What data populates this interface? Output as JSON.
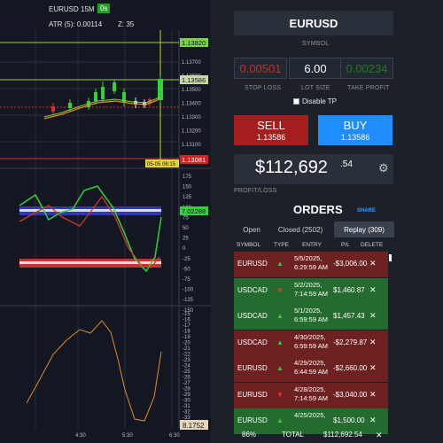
{
  "chart": {
    "symbol_tf": "EURUSD 15M",
    "tf_badge": "0s",
    "atr": "ATR (5): 0.00114",
    "z": "Z: 35",
    "price_ticks": [
      "1.13700",
      "1.13600",
      "1.13500",
      "1.13400",
      "1.13300",
      "1.13200",
      "1.13100"
    ],
    "labels": {
      "top_line": "1.13820",
      "current": "1.13586",
      "stop": "1.13081",
      "time": "05-05 06:15",
      "indicator_green": "7.02288",
      "indicator_orange": "8.1752"
    },
    "indicator_ticks": [
      "175",
      "150",
      "125",
      "100",
      "75",
      "50",
      "25",
      "0",
      "-25",
      "-50",
      "-75",
      "-100",
      "-125",
      "-150"
    ],
    "osc_ticks": [
      "-15",
      "-16",
      "-17",
      "-18",
      "-19",
      "-20",
      "-21",
      "-22",
      "-23",
      "-24",
      "-25",
      "-26",
      "-27",
      "-28",
      "-29",
      "-30",
      "-31",
      "-32",
      "-33"
    ],
    "time_ticks": [
      "4:30",
      "5:30",
      "6:30"
    ]
  },
  "trade": {
    "symbol": "EURUSD",
    "symbol_caption": "SYMBOL",
    "stop_loss": "0.00501",
    "stop_loss_caption": "STOP LOSS",
    "lot_size": "6.00",
    "lot_size_caption": "LOT SIZE",
    "take_profit": "0.00234",
    "take_profit_caption": "TAKE PROFIT",
    "disable_tp": "Disable TP",
    "sell_label": "SELL",
    "sell_price": "1.13586",
    "buy_label": "BUY",
    "buy_price": "1.13586",
    "pl_value": "$112,692",
    "pl_decimal": ".54",
    "pl_caption": "PROFIT/LOSS"
  },
  "orders": {
    "title": "ORDERS",
    "share": "SHARE",
    "tabs": [
      "Open",
      "Closed (2502)",
      "Replay (309)"
    ],
    "columns": [
      "SYMBOL",
      "TYPE",
      "ENTRY",
      "P/L",
      "DELETE"
    ],
    "rows": [
      {
        "symbol": "EURUSD",
        "dir": "up",
        "date": "5/5/2025,",
        "time": "6:29:59 AM",
        "pl": "-$3,006.00"
      },
      {
        "symbol": "USDCAD",
        "dir": "down",
        "date": "5/2/2025,",
        "time": "7:14:59 AM",
        "pl": "$1,460.87"
      },
      {
        "symbol": "USDCAD",
        "dir": "up",
        "date": "5/1/2025,",
        "time": "6:59:59 AM",
        "pl": "$1,457.43"
      },
      {
        "symbol": "USDCAD",
        "dir": "up",
        "date": "4/30/2025,",
        "time": "6:59:59 AM",
        "pl": "-$2,279.87"
      },
      {
        "symbol": "EURUSD",
        "dir": "up",
        "date": "4/29/2025,",
        "time": "6:44:59 AM",
        "pl": "-$2,660.00"
      },
      {
        "symbol": "EURUSD",
        "dir": "down",
        "date": "4/28/2025,",
        "time": "7:14:59 AM",
        "pl": "-$3,040.00"
      },
      {
        "symbol": "EURUSD",
        "dir": "up",
        "date": "4/25/2025,",
        "time": "",
        "pl": "$1,500.00"
      }
    ],
    "delete_glyph": "✕",
    "footer_pct": "86%",
    "footer_total_label": "TOTAL",
    "footer_total": "$112,692.54",
    "footer_close": "✕"
  },
  "colors": {
    "sell": "#a51d1d",
    "buy": "#1f8cff",
    "loss_row": "#6e2121",
    "profit_row": "#236b2e"
  }
}
